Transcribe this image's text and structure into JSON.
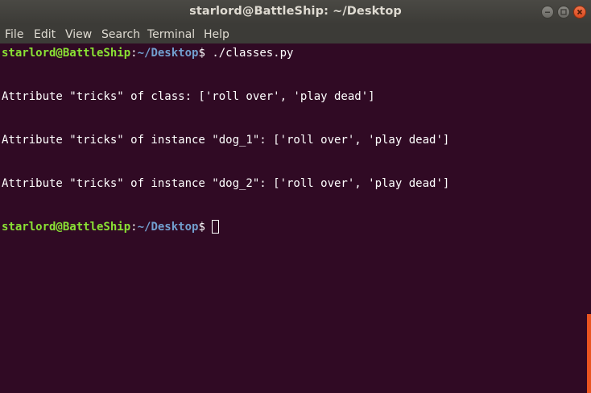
{
  "window": {
    "title": "starlord@BattleShip: ~/Desktop"
  },
  "menu": {
    "items": [
      "File",
      "Edit",
      "View",
      "Search",
      "Terminal",
      "Help"
    ]
  },
  "terminal": {
    "prompt1": {
      "user_host": "starlord@BattleShip",
      "sep": ":",
      "path": "~/Desktop",
      "symbol": "$",
      "command": " ./classes.py"
    },
    "output": [
      "Attribute \"tricks\" of class: ['roll over', 'play dead']",
      "Attribute \"tricks\" of instance \"dog_1\": ['roll over', 'play dead']",
      "Attribute \"tricks\" of instance \"dog_2\": ['roll over', 'play dead']"
    ],
    "prompt2": {
      "user_host": "starlord@BattleShip",
      "sep": ":",
      "path": "~/Desktop",
      "symbol": "$ ",
      "command": ""
    }
  },
  "colors": {
    "background": "#300a24",
    "user": "#8ae234",
    "path": "#729fcf",
    "accent": "#e95420"
  }
}
